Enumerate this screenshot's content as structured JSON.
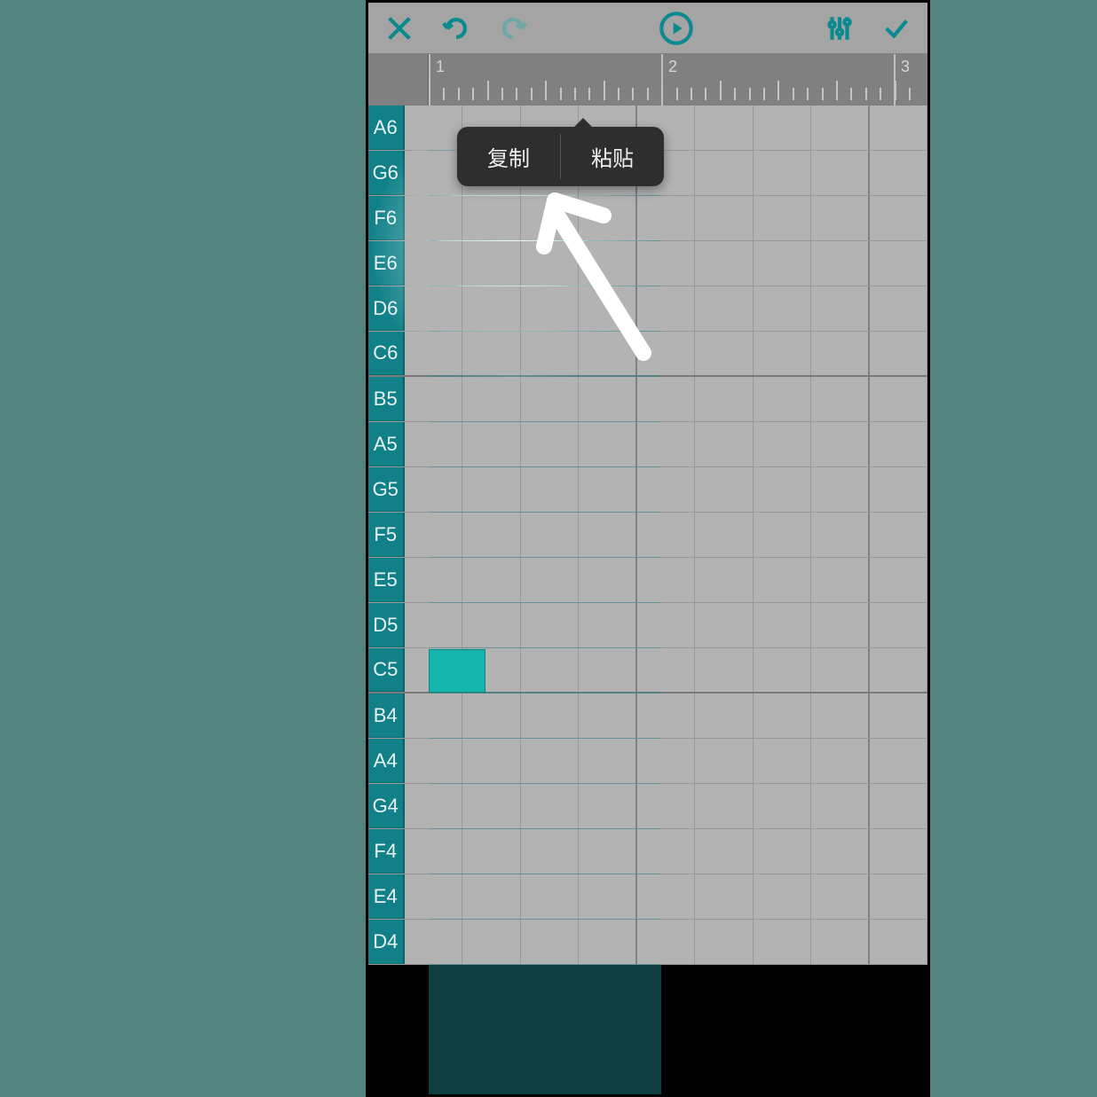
{
  "toolbar": {
    "close": "✕",
    "undo": "↶",
    "redo": "↷",
    "play": "▶",
    "mixer": "|||",
    "confirm": "✓"
  },
  "ruler": {
    "bars": [
      "1",
      "2",
      "3"
    ]
  },
  "notes": [
    "A6",
    "G6",
    "F6",
    "E6",
    "D6",
    "C6",
    "B5",
    "A5",
    "G5",
    "F5",
    "E5",
    "D5",
    "C5",
    "B4",
    "A4",
    "G4",
    "F4",
    "E4",
    "D4"
  ],
  "group_dividers_after": [
    "C6",
    "C5"
  ],
  "selected_bar_width_subdivs": 4,
  "note_blocks": [
    {
      "row": "C5",
      "col": 0,
      "span": 1
    }
  ],
  "context_menu": {
    "copy": "复制",
    "paste": "粘贴"
  },
  "colors": {
    "accent": "#0a8a8f",
    "note_label_bg": "#118088",
    "selection": "rgba(34,140,141,0.45)",
    "note_block": "#15b5ad"
  },
  "grid": {
    "subdivisions_per_bar": 4,
    "visible_bars": 2
  }
}
